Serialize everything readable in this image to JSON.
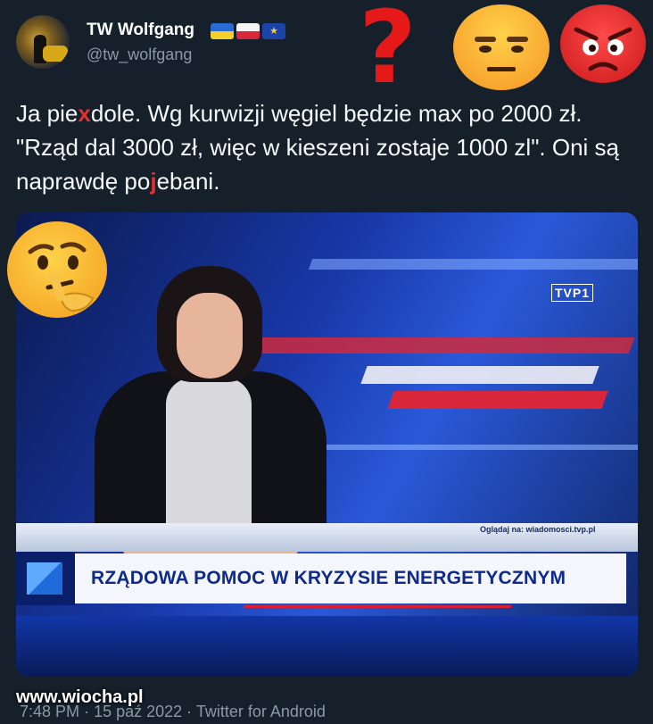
{
  "header": {
    "display_name": "TW Wolfgang",
    "handle": "@tw_wolfgang",
    "flags": [
      "ua",
      "pl",
      "eu"
    ]
  },
  "tweet": {
    "part1": "Ja pie",
    "strike1": "x",
    "part2": "dole. Wg kurwizji węgiel będzie max po 2000 zł. \"Rząd dal 3000 zł, więc w kieszeni zostaje 1000 zl\".  Oni są naprawdę po",
    "strike2": "j",
    "part3": "ebani."
  },
  "overlay": {
    "question_mark": "?",
    "emojis": [
      "annoyed-face-icon",
      "angry-face-icon",
      "thinking-face-icon"
    ]
  },
  "media": {
    "channel_logo": "TVP1",
    "watch_text": "Oglądaj na: wiadomosci.tvp.pl",
    "banner_text": "RZĄDOWA POMOC W KRYZYSIE ENERGETYCZNYM"
  },
  "footer": {
    "time": "7:48 PM",
    "date": "15 paź 2022",
    "client": "Twitter for Android"
  },
  "watermark": "www.wiocha.pl",
  "colors": {
    "background": "#15202b",
    "text": "#f5f7f9",
    "muted": "#8b98a5"
  }
}
